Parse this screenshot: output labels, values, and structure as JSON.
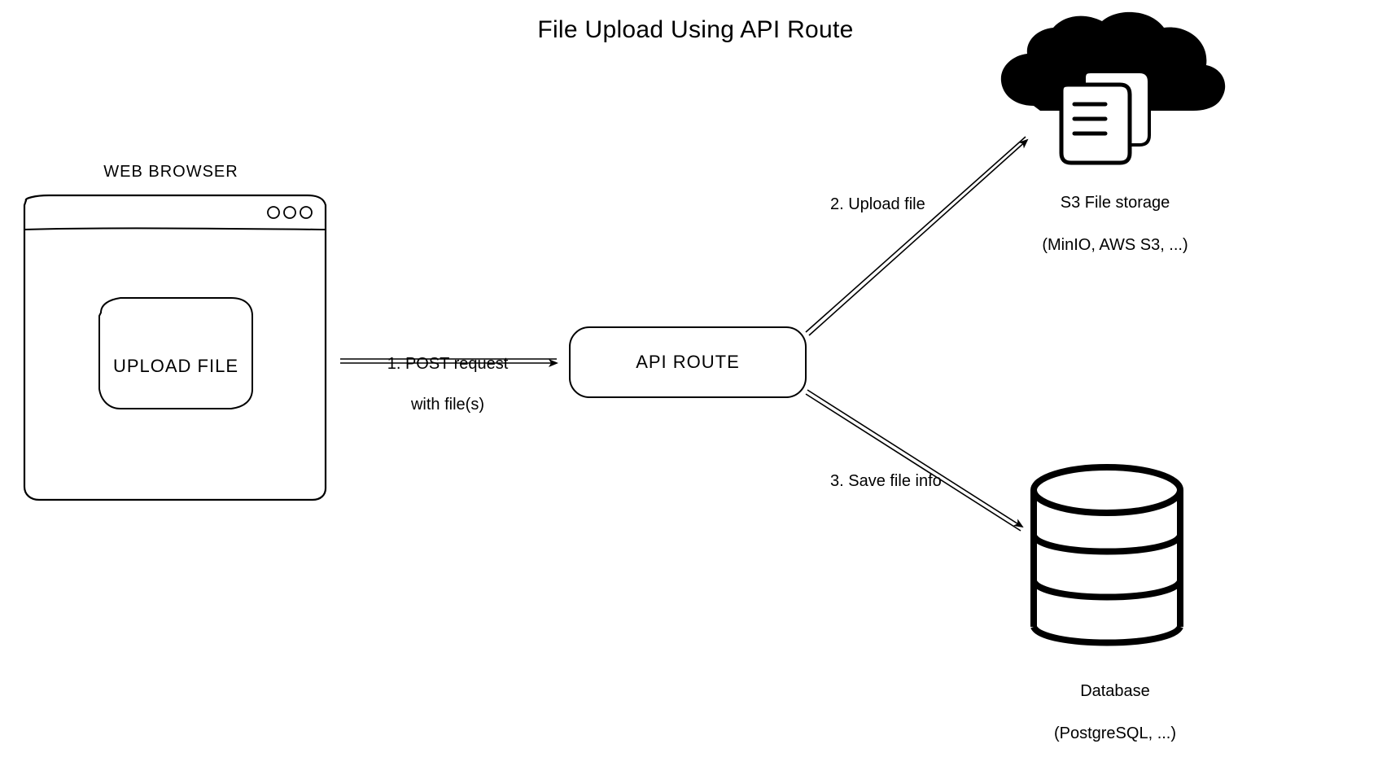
{
  "title": "File Upload Using API Route",
  "browser": {
    "label": "WEB BROWSER",
    "button": "UPLOAD FILE"
  },
  "api": {
    "label": "API ROUTE"
  },
  "s3": {
    "title": "S3 File storage",
    "subtitle": "(MinIO, AWS S3, ...)"
  },
  "db": {
    "title": "Database",
    "subtitle": "(PostgreSQL, ...)"
  },
  "arrows": {
    "post": {
      "line1": "1. POST request",
      "line2": "with file(s)"
    },
    "upload": "2. Upload file",
    "save": "3. Save file info"
  }
}
